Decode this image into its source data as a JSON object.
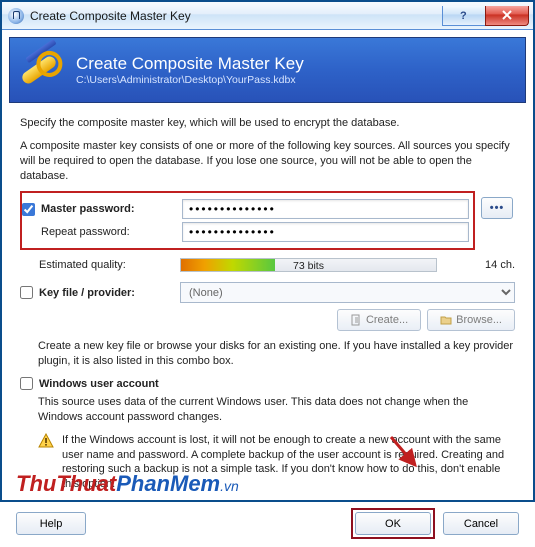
{
  "window": {
    "title": "Create Composite Master Key"
  },
  "banner": {
    "heading": "Create Composite Master Key",
    "path": "C:\\Users\\Administrator\\Desktop\\YourPass.kdbx"
  },
  "intro": {
    "line1": "Specify the composite master key, which will be used to encrypt the database.",
    "line2": "A composite master key consists of one or more of the following key sources. All sources you specify will be required to open the database.  If you lose one source, you will not be able to open the database."
  },
  "master_password": {
    "checkbox_label": "Master password:",
    "checked": true,
    "repeat_label": "Repeat password:",
    "value_masked": "••••••••••••••",
    "repeat_value_masked": "••••••••••••••",
    "quality_label": "Estimated quality:",
    "quality_text": "73 bits",
    "quality_percent": 37,
    "chars_text": "14 ch."
  },
  "keyfile": {
    "checkbox_label": "Key file / provider:",
    "checked": false,
    "selected": "(None)",
    "create_btn": "Create...",
    "browse_btn": "Browse...",
    "help": "Create a new key file or browse your disks for an existing one. If you have installed a key provider plugin, it is also listed in this combo box."
  },
  "winaccount": {
    "checkbox_label": "Windows user account",
    "checked": false,
    "help": "This source uses data of the current Windows user. This data does not change when the Windows account password changes.",
    "warning": "If the Windows account is lost, it will not be enough to create a new account with the same user name and password.  A complete backup of the user account is required. Creating and restoring such a backup is not a simple task. If you don't know how to do this, don't enable this option."
  },
  "footer": {
    "help": "Help",
    "ok": "OK",
    "cancel": "Cancel"
  },
  "watermark": {
    "part1": "ThuThuat",
    "part2": "PhanMem",
    "part3": ".vn"
  }
}
